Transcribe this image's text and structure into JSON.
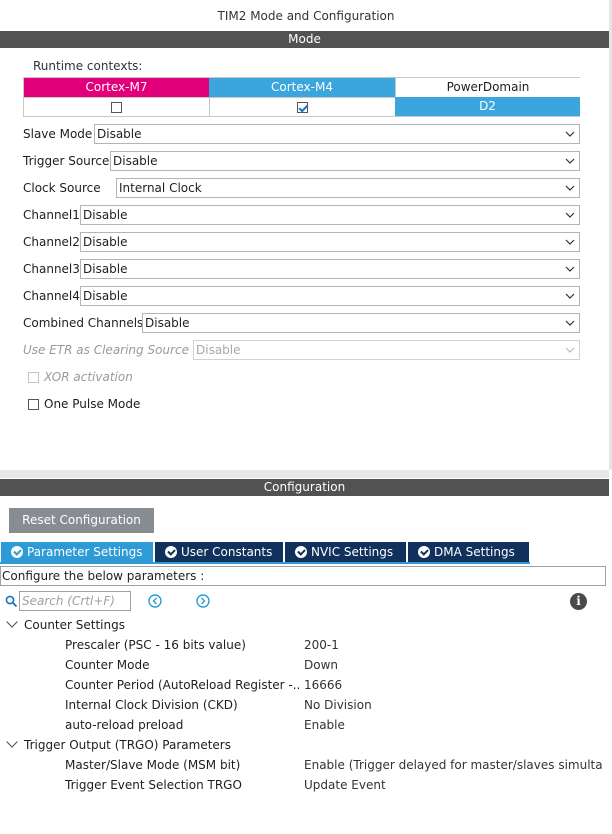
{
  "window": {
    "title": "TIM2 Mode and Configuration"
  },
  "mode": {
    "header": "Mode",
    "runtime_label": "Runtime contexts:",
    "contexts": [
      {
        "name": "Cortex-M7",
        "checked": false,
        "color": "#e2007a"
      },
      {
        "name": "Cortex-M4",
        "checked": true,
        "color": "#3aa6dd"
      },
      {
        "name": "PowerDomain",
        "value": "D2",
        "color": "#3aa6dd"
      }
    ],
    "fields": [
      {
        "label": "Slave Mode",
        "value": "Disable",
        "disabled": false
      },
      {
        "label": "Trigger Source",
        "value": "Disable",
        "disabled": false
      },
      {
        "label": "Clock Source",
        "value": "Internal Clock",
        "disabled": false
      },
      {
        "label": "Channel1",
        "value": "Disable",
        "disabled": false
      },
      {
        "label": "Channel2",
        "value": "Disable",
        "disabled": false
      },
      {
        "label": "Channel3",
        "value": "Disable",
        "disabled": false
      },
      {
        "label": "Channel4",
        "value": "Disable",
        "disabled": false
      },
      {
        "label": "Combined Channels",
        "value": "Disable",
        "disabled": false
      },
      {
        "label": "Use ETR as Clearing Source",
        "value": "Disable",
        "disabled": true
      }
    ],
    "checkboxes": [
      {
        "label": "XOR activation",
        "checked": false,
        "disabled": true
      },
      {
        "label": "One Pulse Mode",
        "checked": false,
        "disabled": false
      }
    ]
  },
  "configuration": {
    "header": "Configuration",
    "reset_label": "Reset Configuration",
    "tabs": [
      {
        "label": "Parameter Settings",
        "active": true
      },
      {
        "label": "User Constants",
        "active": false
      },
      {
        "label": "NVIC Settings",
        "active": false
      },
      {
        "label": "DMA Settings",
        "active": false
      }
    ],
    "instruction": "Configure the below parameters :",
    "search_placeholder": "Search (Crtl+F)",
    "groups": [
      {
        "name": "Counter Settings",
        "params": [
          {
            "name": "Prescaler (PSC - 16 bits value)",
            "value": "200-1"
          },
          {
            "name": "Counter Mode",
            "value": "Down"
          },
          {
            "name": "Counter Period (AutoReload Register -...",
            "value": "16666"
          },
          {
            "name": "Internal Clock Division (CKD)",
            "value": "No Division"
          },
          {
            "name": "auto-reload preload",
            "value": "Enable"
          }
        ]
      },
      {
        "name": "Trigger Output (TRGO) Parameters",
        "params": [
          {
            "name": "Master/Slave Mode (MSM bit)",
            "value": "Enable (Trigger delayed for master/slaves simulta..."
          },
          {
            "name": "Trigger Event Selection TRGO",
            "value": "Update Event"
          }
        ]
      }
    ]
  }
}
